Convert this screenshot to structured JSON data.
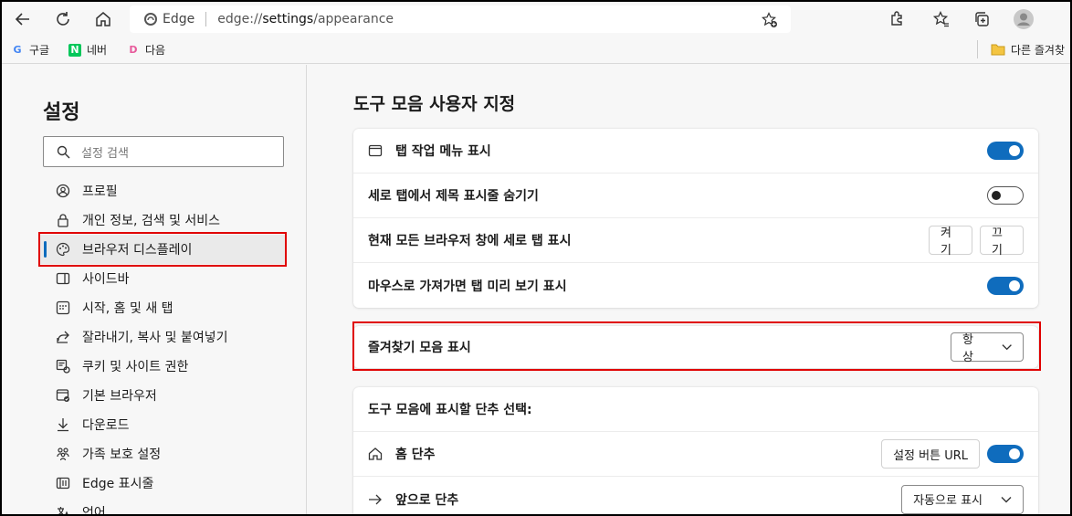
{
  "toolbar": {
    "brand": "Edge",
    "url_prefix": "edge://",
    "url_main": "settings",
    "url_suffix": "/appearance"
  },
  "bookmarks": [
    {
      "label": "구글",
      "icon": "G",
      "color": "#4285f4"
    },
    {
      "label": "네버",
      "icon": "N",
      "color": "#03c75a"
    },
    {
      "label": "다음",
      "icon": "D",
      "color": "#e75a9b"
    }
  ],
  "other_favorites": "다른 즐겨찾",
  "sidebar": {
    "title": "설정",
    "search_placeholder": "설정 검색",
    "items": [
      {
        "label": "프로필",
        "icon": "profile-icon"
      },
      {
        "label": "개인 정보, 검색 및 서비스",
        "icon": "lock-icon"
      },
      {
        "label": "브라우저 디스플레이",
        "icon": "palette-icon",
        "active": true
      },
      {
        "label": "사이드바",
        "icon": "sidebar-icon"
      },
      {
        "label": "시작, 홈 및 새 탭",
        "icon": "start-icon"
      },
      {
        "label": "잘라내기, 복사 및 붙여넣기",
        "icon": "share-icon"
      },
      {
        "label": "쿠키 및 사이트 권한",
        "icon": "cookie-icon"
      },
      {
        "label": "기본 브라우저",
        "icon": "browser-icon"
      },
      {
        "label": "다운로드",
        "icon": "download-icon"
      },
      {
        "label": "가족 보호 설정",
        "icon": "family-icon"
      },
      {
        "label": "Edge 표시줄",
        "icon": "edge-bar-icon"
      },
      {
        "label": "언어",
        "icon": "language-icon"
      }
    ]
  },
  "main": {
    "title": "도구 모음 사용자 지정",
    "tab_rows": [
      {
        "label": "탭 작업 메뉴 표시",
        "toggle": "on"
      },
      {
        "label": "세로 탭에서 제목 표시줄 숨기기",
        "toggle": "off"
      },
      {
        "label": "현재 모든 브라우저 창에 세로 탭 표시",
        "btn_on": "켜기",
        "btn_off": "끄기"
      },
      {
        "label": "마우스로 가져가면 탭 미리 보기 표시",
        "toggle": "on"
      }
    ],
    "favorites_bar": {
      "label": "즐겨찾기 모음 표시",
      "value": "항상"
    },
    "buttons_card": {
      "heading": "도구 모음에 표시할 단추 선택:",
      "home": {
        "label": "홈 단추",
        "button": "설정 버튼 URL",
        "toggle": "on"
      },
      "forward": {
        "label": "앞으로 단추",
        "value": "자동으로 표시"
      }
    }
  }
}
